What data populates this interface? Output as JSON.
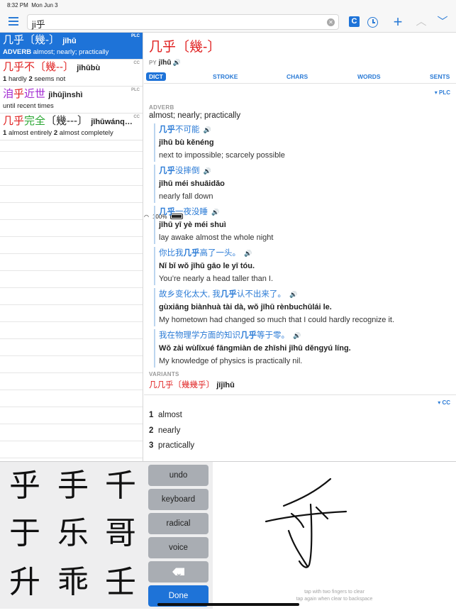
{
  "status": {
    "time": "8:32 PM",
    "date": "Mon Jun 3",
    "battery": "100%"
  },
  "toolbar": {
    "search_value": "ji乎",
    "c_label": "C"
  },
  "results": [
    {
      "hz": "几乎",
      "trad": "〔幾-〕",
      "pinyin": "jīhū",
      "tag": "PLC",
      "def_label": "ADVERB",
      "def": "almost; nearly; practically",
      "selected": true
    },
    {
      "hz": "几乎不",
      "trad": "〔幾--〕",
      "pinyin": "jīhūbù",
      "tag": "CC",
      "def1_num": "1",
      "def1": "hardly",
      "def2_num": "2",
      "def2": "seems not"
    },
    {
      "hz": "洎乎近世",
      "pinyin": "jìhūjìnshì",
      "tag": "PLC",
      "def": "until recent times"
    },
    {
      "hz": "几乎完全",
      "trad": "〔幾---〕",
      "pinyin": "jīhūwánq…",
      "tag": "CC",
      "def1_num": "1",
      "def1": "almost entirely",
      "def2_num": "2",
      "def2": "almost completely"
    }
  ],
  "detail": {
    "headword": "几乎",
    "trad": "〔幾-〕",
    "py_label": "PY",
    "pinyin": "jīhū",
    "tabs": [
      "DICT",
      "STROKE",
      "CHARS",
      "WORDS",
      "SENTS"
    ],
    "source_plc": "▾ PLC",
    "pos": "ADVERB",
    "definition": "almost; nearly; practically",
    "examples": [
      {
        "zh": "几乎不可能",
        "py": "jīhū bù kěnéng",
        "en": "next to impossible; scarcely possible"
      },
      {
        "zh": "几乎没摔倒",
        "py": "jīhū méi shuāidǎo",
        "en": "nearly fall down"
      },
      {
        "zh": "几乎一夜没睡",
        "py": "jīhū yī yè méi shuì",
        "en": "lay awake almost the whole night"
      },
      {
        "zh": "你比我几乎高了一头。",
        "py": "Nǐ bǐ wǒ jīhū gāo le yī tóu.",
        "en": "You’re nearly a head taller than I."
      },
      {
        "zh": "故乡变化太大, 我几乎认不出来了。",
        "py": "gùxiāng biànhuà tài dà, wǒ jīhū rènbuchūlái le.",
        "en": "My hometown had changed so much that I could hardly recognize it."
      },
      {
        "zh": "我在物理学方面的知识几乎等于零。",
        "py": "Wǒ zài wùlǐxué fāngmiàn de zhīshi jīhū děngyú líng.",
        "en": "My knowledge of physics is practically nil."
      }
    ],
    "variants_label": "VARIANTS",
    "variant_hz": "几几乎〔幾幾乎〕",
    "variant_py": "jījīhū",
    "source_cc": "▾ CC",
    "cc_defs": [
      {
        "num": "1",
        "text": "almost"
      },
      {
        "num": "2",
        "text": "nearly"
      },
      {
        "num": "3",
        "text": "practically"
      }
    ]
  },
  "handwriting": {
    "candidates": [
      "乎",
      "手",
      "千",
      "于",
      "乐",
      "哥",
      "升",
      "乖",
      "壬"
    ],
    "keys": {
      "undo": "undo",
      "keyboard": "keyboard",
      "radical": "radical",
      "voice": "voice",
      "done": "Done"
    },
    "hint1": "tap with two fingers to clear",
    "hint2": "tap again when clear to backspace"
  }
}
